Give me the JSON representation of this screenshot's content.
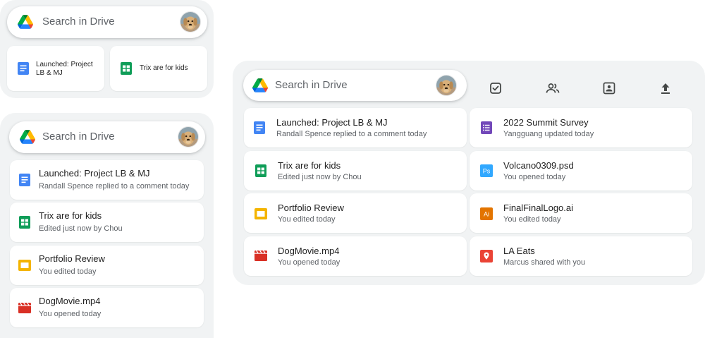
{
  "search": {
    "placeholder": "Search in Drive"
  },
  "colors": {
    "widget_bg": "#f1f3f4",
    "docs": "#4285f4",
    "sheets": "#0f9d58",
    "slides": "#f4b400",
    "video": "#d93025",
    "forms": "#7248b9",
    "photoshop": "#31a8ff",
    "illustrator": "#e37400",
    "maps": "#ea4335"
  },
  "small_widget": {
    "items": [
      {
        "title": "Launched: Project LB & MJ",
        "icon": "docs-icon"
      },
      {
        "title": "Trix are for kids",
        "icon": "sheets-icon"
      }
    ]
  },
  "medium_widget": {
    "items": [
      {
        "title": "Launched: Project LB & MJ",
        "subtitle": "Randall Spence replied to a comment today",
        "icon": "docs-icon"
      },
      {
        "title": "Trix are for kids",
        "subtitle": "Edited just now by Chou",
        "icon": "sheets-icon"
      },
      {
        "title": "Portfolio Review",
        "subtitle": "You edited today",
        "icon": "slides-icon"
      },
      {
        "title": "DogMovie.mp4",
        "subtitle": "You opened today",
        "icon": "video-icon"
      }
    ]
  },
  "large_widget": {
    "toolbar": [
      "new-task-icon",
      "shared-drives-icon",
      "photos-icon",
      "upload-icon"
    ],
    "left_items": [
      {
        "title": "Launched: Project LB & MJ",
        "subtitle": "Randall Spence replied to a comment today",
        "icon": "docs-icon"
      },
      {
        "title": "Trix are for kids",
        "subtitle": "Edited just now by Chou",
        "icon": "sheets-icon"
      },
      {
        "title": "Portfolio Review",
        "subtitle": "You edited today",
        "icon": "slides-icon"
      },
      {
        "title": "DogMovie.mp4",
        "subtitle": "You opened today",
        "icon": "video-icon"
      }
    ],
    "right_items": [
      {
        "title": "2022 Summit Survey",
        "subtitle": "Yangguang updated today",
        "icon": "forms-icon"
      },
      {
        "title": "Volcano0309.psd",
        "subtitle": "You opened today",
        "icon": "photoshop-icon",
        "badge": "Ps"
      },
      {
        "title": "FinalFinalLogo.ai",
        "subtitle": "You edited today",
        "icon": "illustrator-icon",
        "badge": "Ai"
      },
      {
        "title": "LA Eats",
        "subtitle": "Marcus shared with you",
        "icon": "maps-pin-icon"
      }
    ]
  }
}
